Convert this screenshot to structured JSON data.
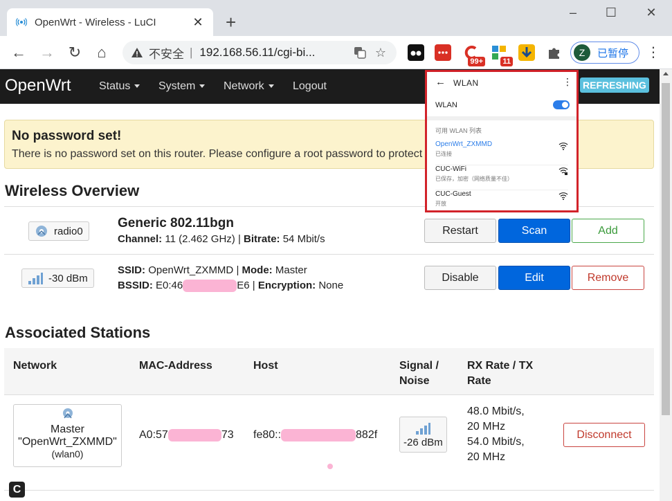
{
  "browser": {
    "tab_title": "OpenWrt - Wireless - LuCI",
    "tab_close": "✕",
    "new_tab": "+",
    "omnibox": {
      "security_label": "不安全",
      "separator": "|",
      "url": "192.168.56.11/cgi-bi..."
    },
    "extension_badges": [
      "99+",
      "11"
    ],
    "profile": {
      "initial": "Z",
      "status": "已暂停"
    }
  },
  "luci": {
    "brand": "OpenWrt",
    "menu": [
      "Status",
      "System",
      "Network",
      "Logout"
    ],
    "refresh_badge": "REFRESHING",
    "alert": {
      "title": "No password set!",
      "text": "There is no password set on this router. Please configure a root password to protect the web interface."
    },
    "wireless_overview": {
      "heading": "Wireless Overview",
      "radio": {
        "name": "radio0",
        "model": "Generic 802.11bgn",
        "channel_label": "Channel:",
        "channel_value": "11 (2.462 GHz)",
        "bitrate_label": "Bitrate:",
        "bitrate_value": "54 Mbit/s",
        "buttons": [
          "Restart",
          "Scan",
          "Add"
        ]
      },
      "network": {
        "signal": "-30 dBm",
        "ssid_label": "SSID:",
        "ssid_value": "OpenWrt_ZXMMD",
        "mode_label": "Mode:",
        "mode_value": "Master",
        "bssid_label": "BSSID:",
        "bssid_prefix": "E0:46",
        "bssid_suffix": "E6",
        "encryption_label": "Encryption:",
        "encryption_value": "None",
        "separator": "|",
        "buttons": [
          "Disable",
          "Edit",
          "Remove"
        ]
      }
    },
    "associated_stations": {
      "heading": "Associated Stations",
      "columns": [
        "Network",
        "MAC-Address",
        "Host",
        "Signal / Noise",
        "RX Rate / TX Rate"
      ],
      "column_lines": {
        "signal": [
          "Signal /",
          "Noise"
        ],
        "rate": [
          "RX Rate / TX",
          "Rate"
        ]
      },
      "rows": [
        {
          "network_lines": [
            "Master",
            "\"OpenWrt_ZXMMD\"",
            "(wlan0)"
          ],
          "mac_prefix": "A0:57",
          "mac_suffix": "73",
          "host_prefix": "fe80::",
          "host_suffix": "882f",
          "signal": "-26 dBm",
          "rates": [
            "48.0 Mbit/s,",
            "20 MHz",
            "54.0 Mbit/s,",
            "20 MHz"
          ],
          "action": "Disconnect"
        }
      ]
    },
    "bottom_icon_letter": "C"
  },
  "phone_overlay": {
    "title": "WLAN",
    "toggle_label": "WLAN",
    "toggle_on": true,
    "section_label": "可用 WLAN 列表",
    "networks": [
      {
        "name": "OpenWrt_ZXMMD",
        "status": "已连接",
        "active": true
      },
      {
        "name": "CUC-WiFi",
        "status": "已保存，加密（网络质量不佳）",
        "active": false
      },
      {
        "name": "CUC-Guest",
        "status": "开放",
        "active": false
      }
    ]
  },
  "colors": {
    "navbar": "#1c1c1c",
    "primary_button": "#0066dd",
    "refresh_badge": "#5bc0de",
    "alert_bg": "#fcf3cd",
    "overlay_border": "#d2232a",
    "redaction": "#fbb4d4"
  }
}
